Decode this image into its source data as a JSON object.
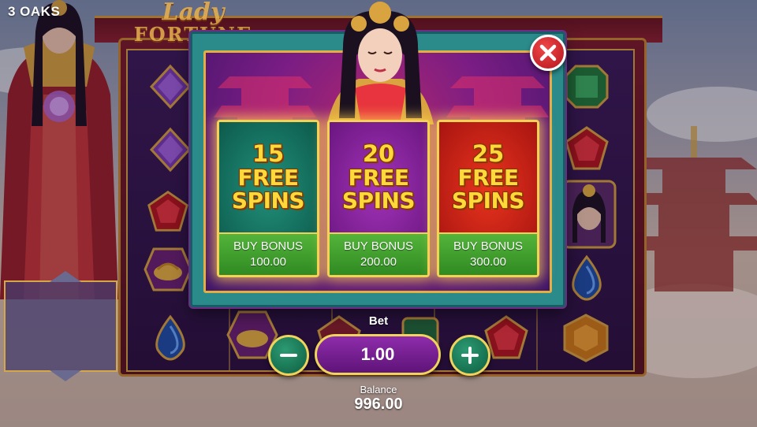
{
  "brand": {
    "name": "3 OAKS"
  },
  "game": {
    "logo_line1": "Lady",
    "logo_line2": "FORTUNE"
  },
  "bonus_options": [
    {
      "spins": "15",
      "word1": "FREE",
      "word2": "SPINS",
      "buy_label": "BUY BONUS",
      "price": "100.00",
      "theme": "green"
    },
    {
      "spins": "20",
      "word1": "FREE",
      "word2": "SPINS",
      "buy_label": "BUY BONUS",
      "price": "200.00",
      "theme": "purple"
    },
    {
      "spins": "25",
      "word1": "FREE",
      "word2": "SPINS",
      "buy_label": "BUY BONUS",
      "price": "300.00",
      "theme": "red"
    }
  ],
  "bet": {
    "label": "Bet",
    "value": "1.00"
  },
  "balance": {
    "label": "Balance",
    "value": "996.00"
  },
  "icons": {
    "close": "close-icon",
    "minus": "minus-icon",
    "plus": "plus-icon"
  },
  "colors": {
    "card_border": "#f3d255",
    "buy_green": "#3f9e2c",
    "close_red": "#d8262a",
    "panel_purple": "#7a1d84"
  }
}
